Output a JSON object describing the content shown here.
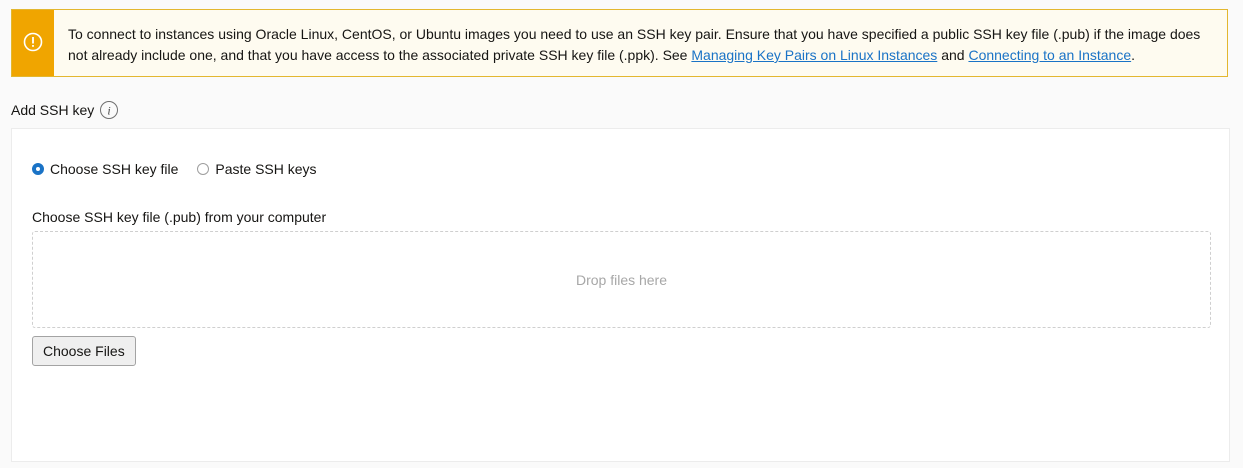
{
  "banner": {
    "icon": "warning-icon",
    "accent_color": "#f0a500",
    "text_before": "To connect to instances using Oracle Linux, CentOS, or Ubuntu images you need to use an SSH key pair. Ensure that you have specified a public SSH key file (.pub) if the image does not already include one, and that you have access to the associated private SSH key file (.ppk). See ",
    "link1": "Managing Key Pairs on Linux Instances",
    "text_middle": " and ",
    "link2": "Connecting to an Instance",
    "text_after": "."
  },
  "section": {
    "label": "Add SSH key",
    "info_icon": "info-icon"
  },
  "radio_options": [
    {
      "label": "Choose SSH key file",
      "checked": true
    },
    {
      "label": "Paste SSH keys",
      "checked": false
    }
  ],
  "file_input": {
    "label": "Choose SSH key file (.pub) from your computer",
    "dropzone_text": "Drop files here",
    "button_label": "Choose Files"
  },
  "colors": {
    "link": "#1a73c6",
    "radio_selected": "#1a73c6"
  }
}
